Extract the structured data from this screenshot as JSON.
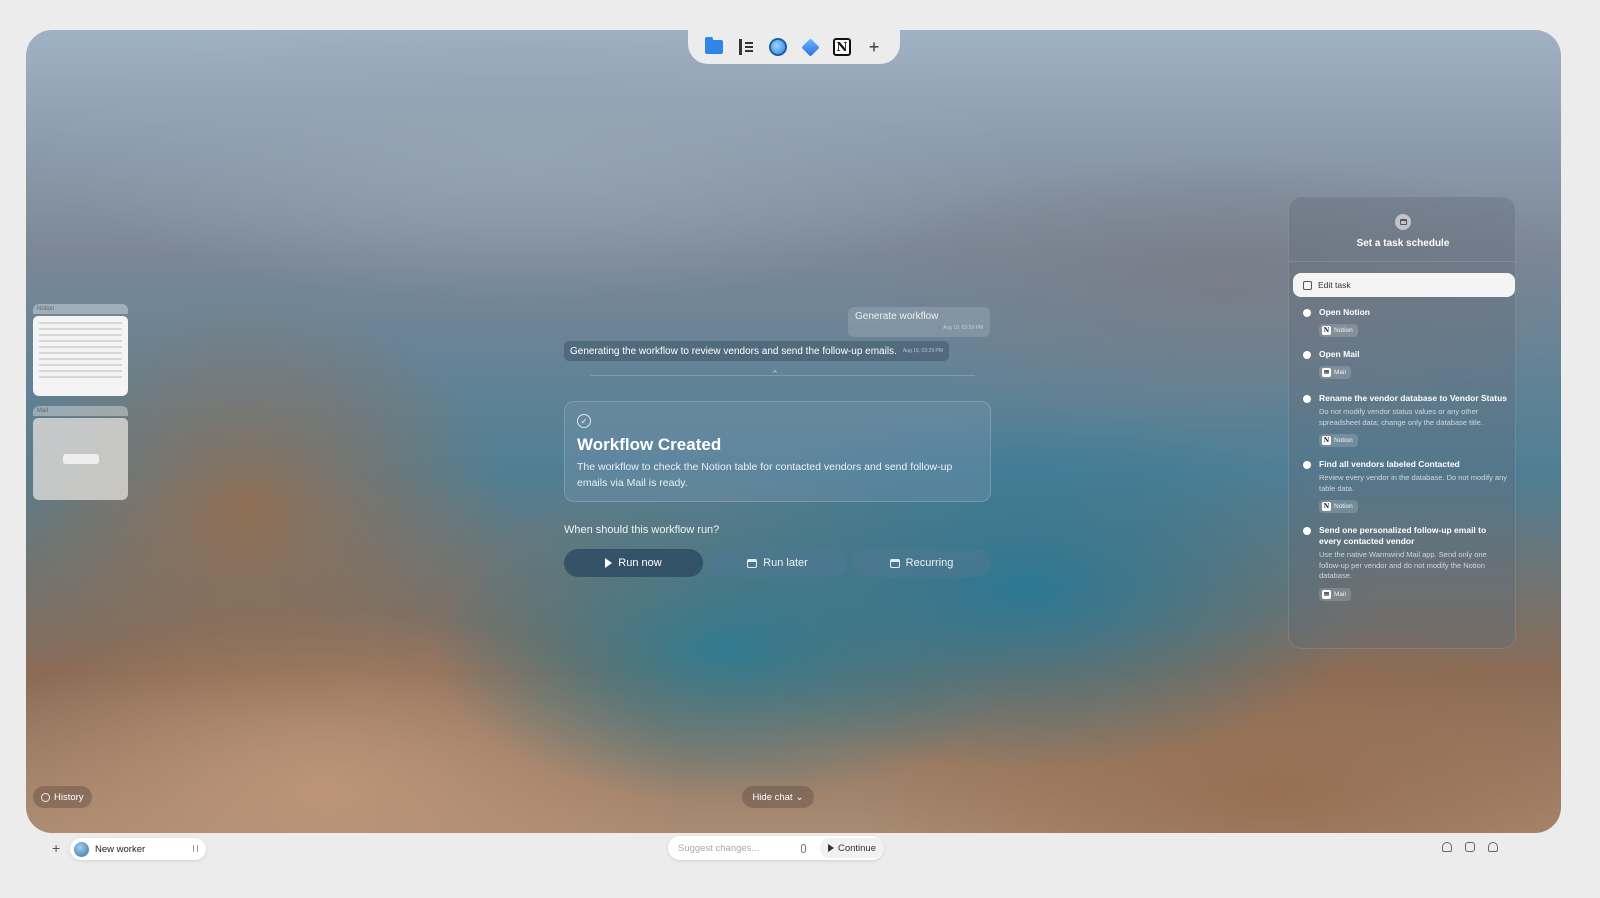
{
  "dock": {
    "items": [
      {
        "name": "folder-icon"
      },
      {
        "name": "sidebar-list-icon"
      },
      {
        "name": "browser-icon"
      },
      {
        "name": "diamond-app-icon"
      },
      {
        "name": "notion-icon",
        "glyph": "N"
      },
      {
        "name": "add-icon",
        "glyph": "+"
      }
    ]
  },
  "thumbnails": [
    {
      "app": "Notion"
    },
    {
      "app": "Mail"
    }
  ],
  "chat": {
    "user_message": "Generate workflow",
    "user_time": "Aug 19, 03:29 PM",
    "agent_message": "Generating the workflow to review vendors and send the follow-up emails.",
    "agent_time": "Aug 19, 03:29 PM",
    "card_title": "Workflow Created",
    "card_desc": "The workflow to check the Notion table for contacted vendors and send follow-up emails via Mail is ready.",
    "question": "When should this workflow run?",
    "run_now": "Run now",
    "run_later": "Run later",
    "recurring": "Recurring"
  },
  "panel": {
    "title": "Set a task schedule",
    "edit_task": "Edit task",
    "steps": [
      {
        "title": "Open Notion",
        "desc": "",
        "app": "Notion"
      },
      {
        "title": "Open Mail",
        "desc": "",
        "app": "Mail"
      },
      {
        "title": "Rename the vendor database to Vendor Status",
        "desc": "Do not modify vendor status values or any other spreadsheet data; change only the database title.",
        "app": "Notion"
      },
      {
        "title": "Find all vendors labeled Contacted",
        "desc": "Review every vendor in the database. Do not modify any table data.",
        "app": "Notion"
      },
      {
        "title": "Send one personalized follow-up email to every contacted vendor",
        "desc": "Use the native Warmwind Mail app. Send only one follow-up per vendor and do not modify the Notion database.",
        "app": "Mail"
      }
    ]
  },
  "history_label": "History",
  "hide_chat_label": "Hide chat",
  "bottom": {
    "worker_name": "New worker",
    "suggest_placeholder": "Suggest changes...",
    "continue_label": "Continue"
  },
  "colors": {
    "accent_dark": "#28465f",
    "panel_bg": "#5f6978",
    "page_bg": "#ececec"
  }
}
